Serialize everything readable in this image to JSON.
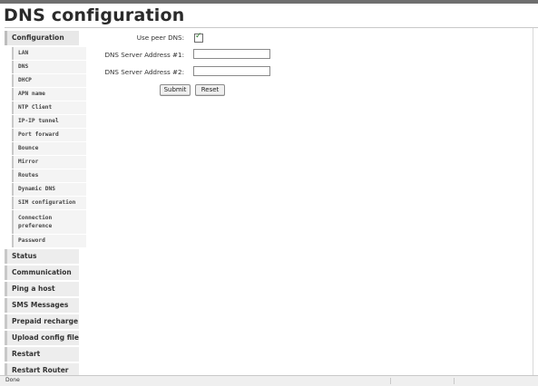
{
  "page": {
    "title": "DNS configuration"
  },
  "sidebar": {
    "configuration": {
      "label": "Configuration"
    },
    "config_items": [
      {
        "id": "lan",
        "label": "LAN"
      },
      {
        "id": "dns",
        "label": "DNS"
      },
      {
        "id": "dhcp",
        "label": "DHCP"
      },
      {
        "id": "apn",
        "label": "APN name"
      },
      {
        "id": "ntp",
        "label": "NTP Client"
      },
      {
        "id": "ipip",
        "label": "IP-IP tunnel"
      },
      {
        "id": "portfwd",
        "label": "Port forward"
      },
      {
        "id": "bounce",
        "label": "Bounce"
      },
      {
        "id": "mirror",
        "label": "Mirror"
      },
      {
        "id": "routes",
        "label": "Routes"
      },
      {
        "id": "ddns",
        "label": "Dynamic DNS"
      },
      {
        "id": "sim",
        "label": "SIM configuration"
      },
      {
        "id": "connpref",
        "label": "Connection preference"
      },
      {
        "id": "password",
        "label": "Password"
      }
    ],
    "main_items": [
      {
        "id": "status",
        "label": "Status"
      },
      {
        "id": "commlog",
        "label": "Communication log"
      },
      {
        "id": "ping",
        "label": "Ping a host"
      },
      {
        "id": "sms",
        "label": "SMS Messages"
      },
      {
        "id": "prepaid",
        "label": "Prepaid recharge"
      },
      {
        "id": "upload",
        "label": "Upload config file"
      },
      {
        "id": "restartconn",
        "label": "Restart Connection"
      },
      {
        "id": "restartrouter",
        "label": "Restart Router"
      }
    ]
  },
  "form": {
    "use_peer_dns": {
      "label": "Use peer DNS:",
      "checked": true,
      "tick": "✓"
    },
    "dns1": {
      "label": "DNS Server Address #1:",
      "value": ""
    },
    "dns2": {
      "label": "DNS Server Address #2:",
      "value": ""
    },
    "submit_label": "Submit",
    "reset_label": "Reset"
  },
  "statusbar": {
    "text": "Done"
  },
  "colors": {
    "accent_check": "#2e7d2e",
    "sidebar_bg": "#ededed"
  }
}
